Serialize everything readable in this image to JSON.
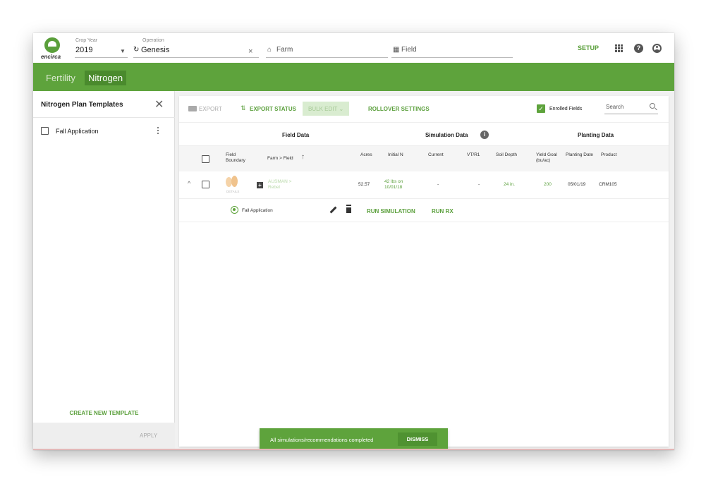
{
  "topbar": {
    "logo_text": "encirca",
    "crop_year_label": "Crop Year",
    "crop_year_value": "2019",
    "operation_label": "Operation",
    "operation_value": "Genesis",
    "farm_placeholder": "Farm",
    "field_placeholder": "Field",
    "setup_label": "SETUP",
    "help_icon_glyph": "?",
    "clear_glyph": "×"
  },
  "tabs": [
    {
      "label": "Fertility",
      "active": false
    },
    {
      "label": "Nitrogen",
      "active": true
    }
  ],
  "left_panel": {
    "title": "Nitrogen Plan Templates",
    "close_glyph": "✕",
    "templates": [
      {
        "label": "Fall Application"
      }
    ],
    "create_label": "CREATE NEW TEMPLATE",
    "apply_label": "APPLY"
  },
  "toolbar": {
    "export_label": "EXPORT",
    "export_status_label": "EXPORT STATUS",
    "bulk_edit_label": "BULK EDIT",
    "rollover_label": "ROLLOVER SETTINGS",
    "enrolled_label": "Enrolled Fields",
    "search_placeholder": "Search"
  },
  "groups": {
    "field_data": "Field Data",
    "simulation_data": "Simulation Data",
    "planting_data": "Planting Data"
  },
  "columns": {
    "field_boundary": "Field Boundary",
    "farm_field": "Farm > Field",
    "acres": "Acres",
    "initial_n": "Initial N",
    "current": "Current",
    "vt_r1": "VT/R1",
    "soil_depth": "Soil Depth",
    "yield_goal": "Yield Goal (bu/ac)",
    "planting_date": "Planting Date",
    "product": "Product"
  },
  "rows": [
    {
      "details_label": "DETAILS",
      "farm": "AUSMAN >",
      "field": "Rebel",
      "acres": "52.57",
      "initial_n": "42 lbs on 10/01/18",
      "current": "-",
      "vt_r1": "-",
      "soil_depth": "24 in.",
      "yield_goal": "200",
      "planting_date": "05/01/19",
      "product": "CRM105",
      "plan": {
        "name": "Fall Application",
        "run_simulation": "RUN SIMULATION",
        "run_rx": "RUN RX"
      }
    }
  ],
  "snackbar": {
    "message": "All simulations/recommendations completed",
    "dismiss": "DISMISS"
  },
  "colors": {
    "brand_green": "#5ea33c",
    "active_tab": "#4a8a2d"
  }
}
